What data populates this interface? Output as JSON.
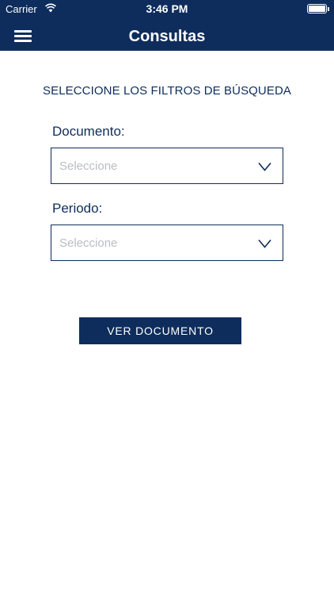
{
  "status_bar": {
    "carrier": "Carrier",
    "time": "3:46 PM",
    "wifi_icon": "wifi-icon",
    "battery_icon": "battery-icon"
  },
  "header": {
    "title": "Consultas",
    "menu_icon": "hamburger-menu-icon"
  },
  "form": {
    "heading": "SELECCIONE LOS FILTROS DE BÚSQUEDA",
    "document_label": "Documento:",
    "document_placeholder": "Seleccione",
    "period_label": "Periodo:",
    "period_placeholder": "Seleccione",
    "submit_label": "VER DOCUMENTO"
  },
  "colors": {
    "brand": "#0e2d5c",
    "placeholder": "#b9bdc4",
    "background": "#ffffff"
  }
}
